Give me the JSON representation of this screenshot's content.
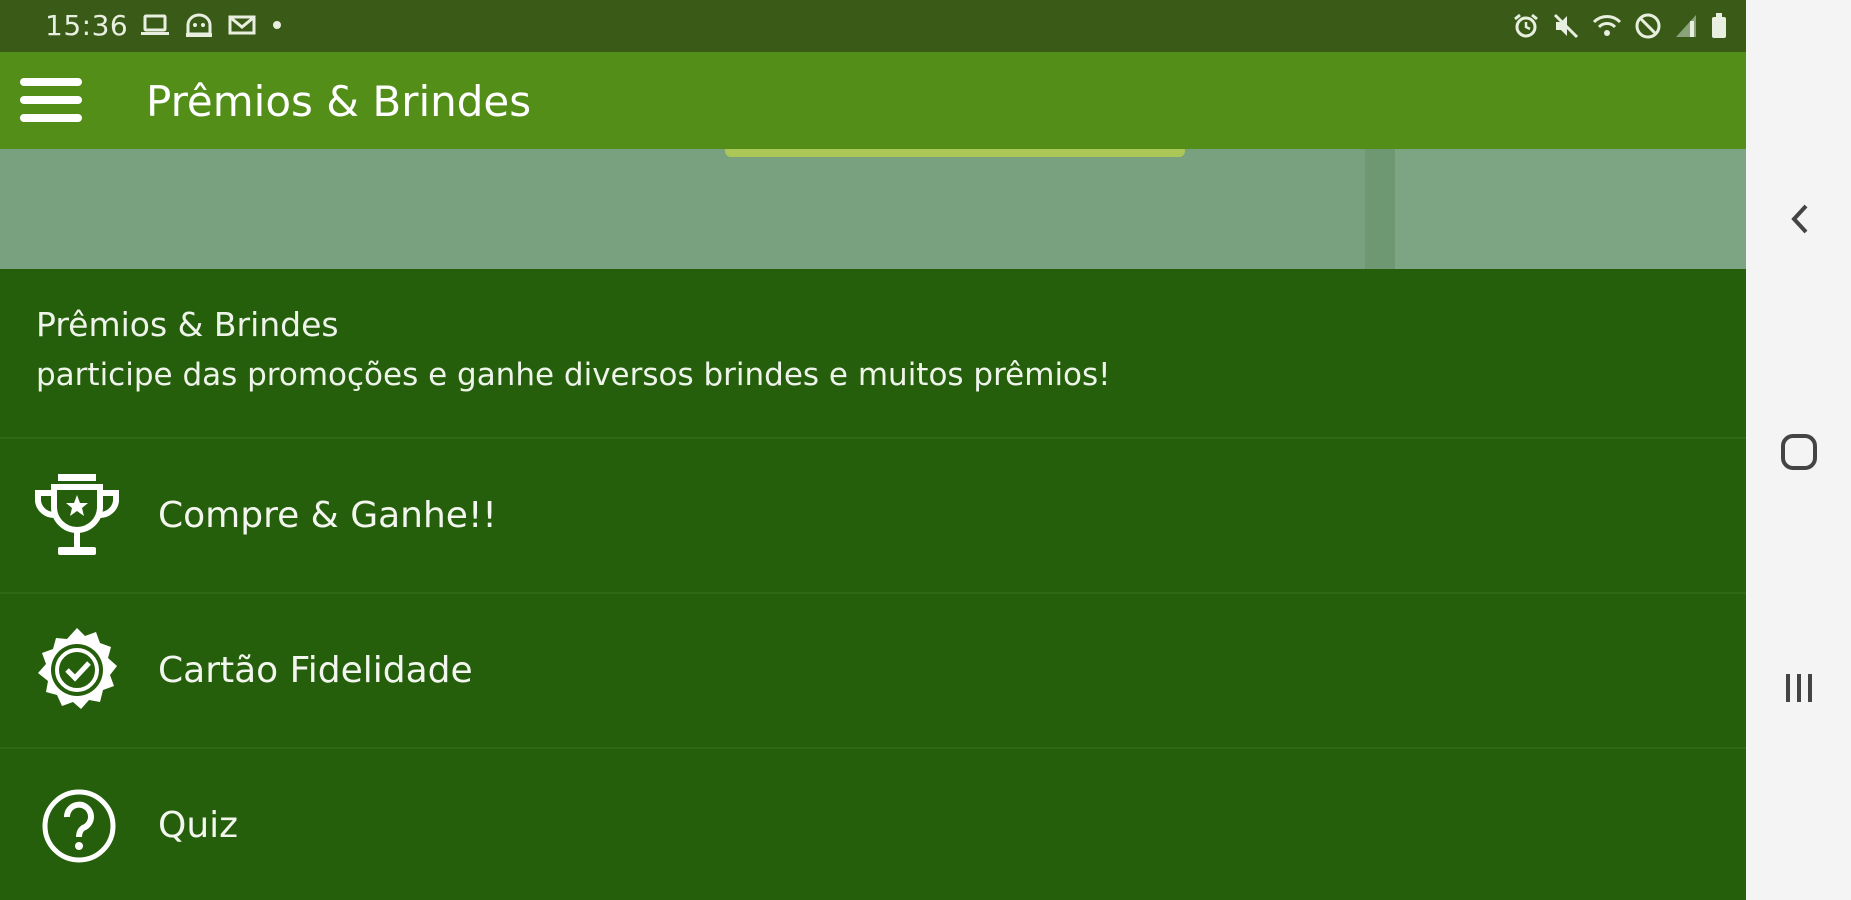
{
  "status_bar": {
    "time": "15:36",
    "left_icons": [
      "laptop-icon",
      "android-debug-icon",
      "mail-icon",
      "dot-icon"
    ],
    "right_icons": [
      "alarm-icon",
      "mute-icon",
      "wifi-icon",
      "do-not-disturb-icon",
      "signal-icon",
      "battery-icon"
    ]
  },
  "app_bar": {
    "menu_icon": "hamburger-menu-icon",
    "title": "Prêmios & Brindes"
  },
  "section": {
    "title": "Prêmios & Brindes",
    "subtitle": "participe das promoções e ganhe diversos brindes e muitos prêmios!"
  },
  "menu": {
    "items": [
      {
        "label": "Compre & Ganhe!!",
        "icon": "trophy-icon"
      },
      {
        "label": "Cartão Fidelidade",
        "icon": "badge-check-icon"
      },
      {
        "label": "Quiz",
        "icon": "question-circle-icon"
      }
    ]
  },
  "navigation": {
    "buttons": [
      "back-icon",
      "home-icon",
      "recents-icon"
    ]
  },
  "colors": {
    "status_bar": "#3a5b18",
    "app_bar": "#528e18",
    "content_background": "#255f0c",
    "banner": "#7aa17f",
    "nav_background": "#f3f4f3"
  }
}
